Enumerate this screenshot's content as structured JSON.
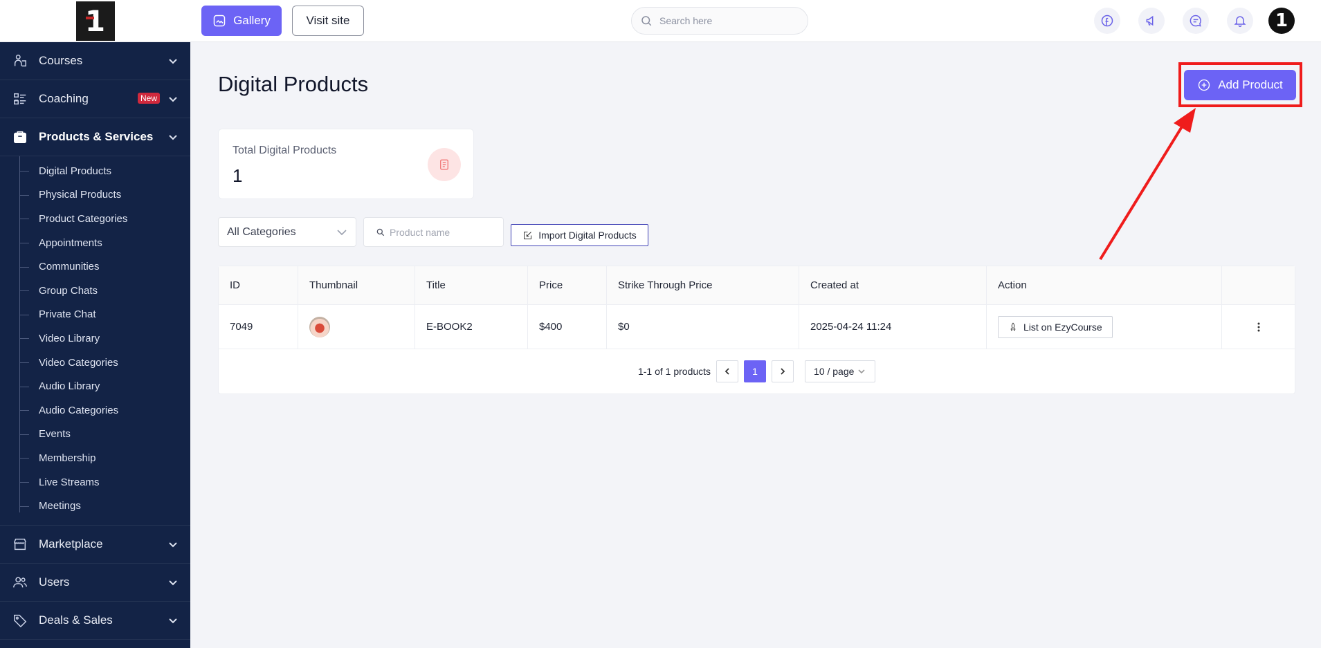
{
  "brand": {
    "logo_text": "1"
  },
  "sidebar": {
    "sections_top": [
      {
        "label": "Courses",
        "icon": "courses-icon"
      },
      {
        "label": "Coaching",
        "icon": "coaching-icon",
        "badge": "New"
      }
    ],
    "active_section": {
      "label": "Products & Services",
      "icon": "products-icon"
    },
    "sub_items": [
      "Digital Products",
      "Physical Products",
      "Product Categories",
      "Appointments",
      "Communities",
      "Group Chats",
      "Private Chat",
      "Video Library",
      "Video Categories",
      "Audio Library",
      "Audio Categories",
      "Events",
      "Membership",
      "Live Streams",
      "Meetings"
    ],
    "sections_bottom": [
      {
        "label": "Marketplace",
        "icon": "marketplace-icon"
      },
      {
        "label": "Users",
        "icon": "users-icon"
      },
      {
        "label": "Deals & Sales",
        "icon": "deals-icon"
      }
    ]
  },
  "topbar": {
    "gallery_label": "Gallery",
    "visit_label": "Visit site",
    "search_placeholder": "Search here",
    "avatar_text": "1"
  },
  "page": {
    "title": "Digital Products",
    "add_label": "Add Product",
    "stat_label": "Total Digital Products",
    "stat_value": "1"
  },
  "filters": {
    "category_selected": "All Categories",
    "search_placeholder": "Product name",
    "import_label": "Import Digital Products"
  },
  "table": {
    "columns": [
      "ID",
      "Thumbnail",
      "Title",
      "Price",
      "Strike Through Price",
      "Created at",
      "Action"
    ],
    "rows": [
      {
        "id": "7049",
        "title": "E-BOOK2",
        "price": "$400",
        "strike_price": "$0",
        "created": "2025-04-24 11:24",
        "action_label": "List on EzyCourse"
      }
    ]
  },
  "pagination": {
    "summary": "1-1 of 1 products",
    "current": "1",
    "page_size": "10 / page"
  },
  "colors": {
    "accent": "#6c63f5",
    "sidebar_bg": "#132346",
    "highlight": "#ef1c1c"
  }
}
